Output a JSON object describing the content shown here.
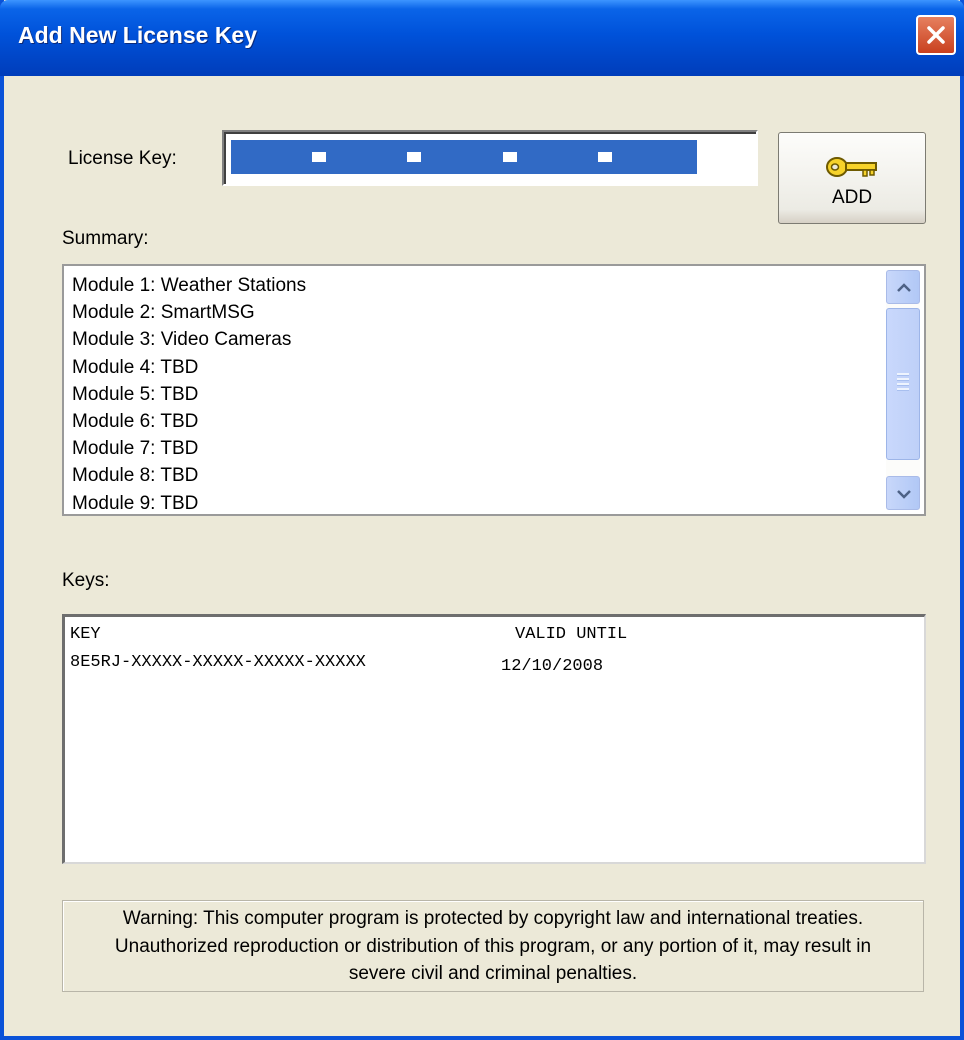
{
  "window": {
    "title": "Add New License Key"
  },
  "license_key": {
    "label": "License Key:",
    "value": "",
    "add_label": "ADD"
  },
  "summary": {
    "label": "Summary:",
    "items": [
      "Module 1: Weather Stations",
      "Module 2: SmartMSG",
      "Module 3: Video Cameras",
      "Module 4: TBD",
      "Module 5: TBD",
      "Module 6: TBD",
      "Module 7: TBD",
      "Module 8: TBD",
      "Module 9: TBD"
    ]
  },
  "keys": {
    "label": "Keys:",
    "header_key": "KEY",
    "header_valid": "VALID UNTIL",
    "rows": [
      {
        "key": "8E5RJ-XXXXX-XXXXX-XXXXX-XXXXX",
        "valid_until": "12/10/2008"
      }
    ]
  },
  "warning": {
    "lines": [
      "Warning:  This computer program is protected by copyright law and international treaties.",
      "Unauthorized reproduction or distribution of this program, or any portion of it, may result in",
      "severe civil and criminal penalties."
    ]
  },
  "icons": {
    "close": "close-x-icon",
    "add": "key-icon",
    "scroll_up": "chevron-up-icon",
    "scroll_down": "chevron-down-icon"
  },
  "colors": {
    "titlebar": "#0052DA",
    "dialog_bg": "#ECE9D8",
    "selection": "#316AC5",
    "close_button": "#D9542F"
  }
}
